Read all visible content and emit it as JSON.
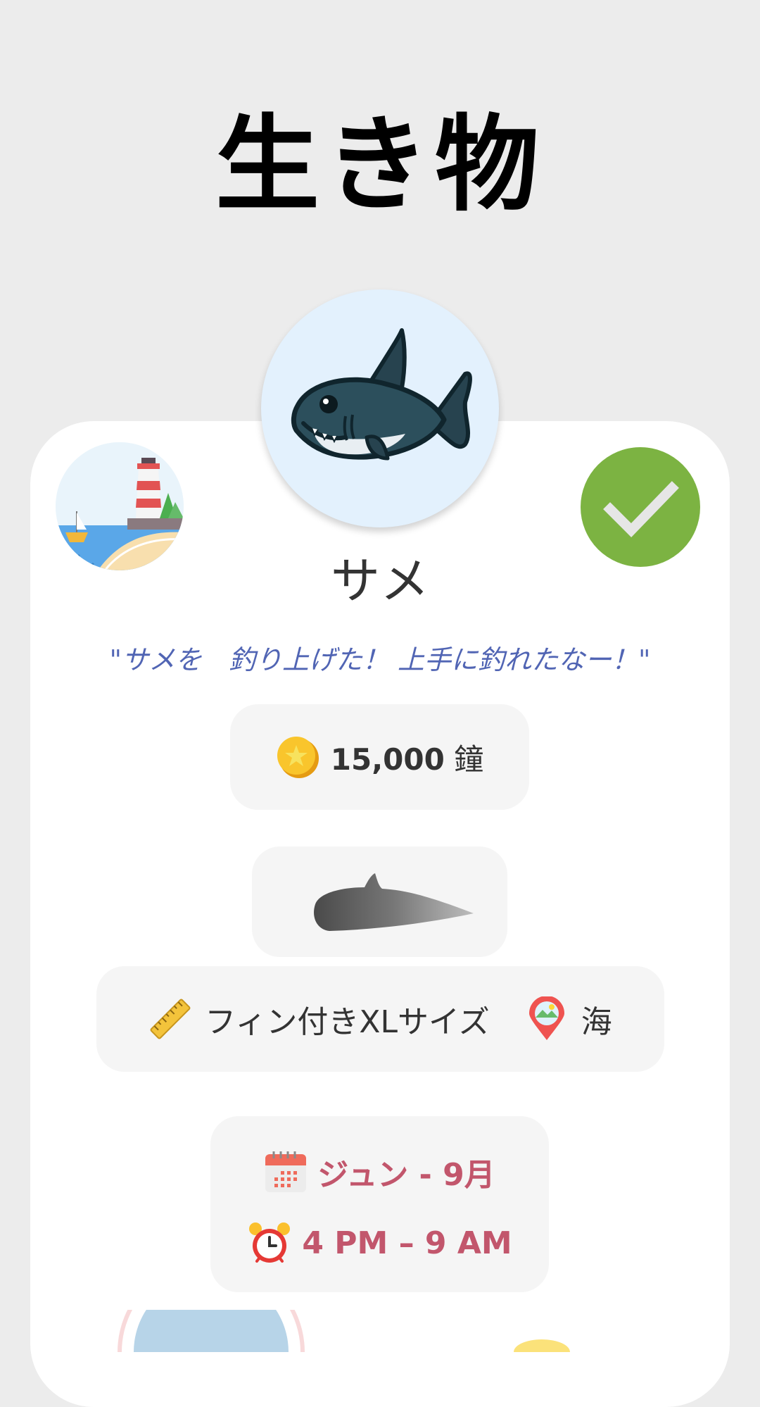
{
  "page": {
    "title": "生き物"
  },
  "creature": {
    "name": "サメ",
    "catch_quote": "\"サメを　釣り上げた！ 上手に釣れたなー！\"",
    "price_value": "15,000",
    "price_unit": "鐘",
    "shadow_size": "フィン付きXLサイズ",
    "location": "海",
    "months": "ジュン - 9月",
    "time": "4 PM – 9 AM",
    "caught": true
  },
  "icons": {
    "hero": "shark-icon",
    "location": "lighthouse-beach-icon",
    "caught": "checkmark-icon",
    "price": "bell-coin-icon",
    "shadow": "fin-shadow-icon",
    "size": "ruler-icon",
    "place": "map-pin-icon",
    "months": "calendar-icon",
    "time": "alarm-clock-icon"
  },
  "colors": {
    "background": "#ececec",
    "card": "#ffffff",
    "pill": "#f5f5f5",
    "check_green": "#7cb342",
    "quote_blue": "#5165b4",
    "time_accent": "#c2566c",
    "hero_bg": "#e3f1fd"
  }
}
